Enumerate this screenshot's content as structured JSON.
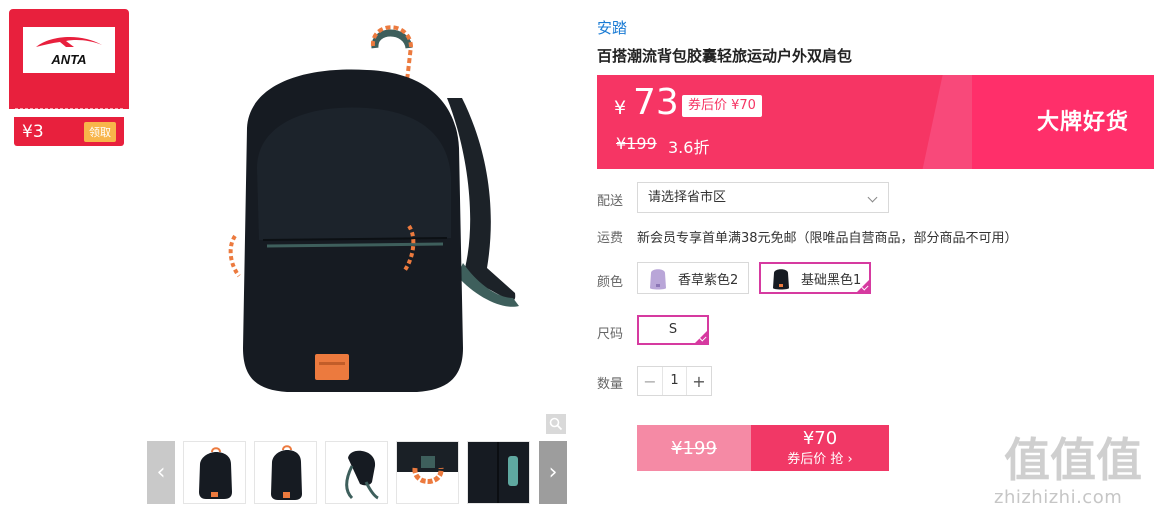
{
  "coupon": {
    "brand_logo_text": "ANTA",
    "amount": "¥3",
    "claim_label": "领取",
    "color": "#e8203d"
  },
  "gallery": {
    "zoom_icon": "magnifier-icon",
    "prev_icon": "chevron-left-icon",
    "next_icon": "chevron-right-icon",
    "thumbnails": [
      "backpack-front",
      "backpack-front-angle",
      "backpack-back-straps",
      "backpack-handle-detail",
      "backpack-side-pocket"
    ]
  },
  "product": {
    "brand": "安踏",
    "title": "百搭潮流背包胶囊轻旅运动户外双肩包"
  },
  "price_banner": {
    "yen": "¥",
    "price": "73",
    "after_coupon": "券后价 ¥70",
    "original_price": "¥199",
    "discount": "3.6折",
    "slogan": "大牌好货",
    "color": "#f63564"
  },
  "delivery": {
    "label": "配送",
    "placeholder": "请选择省市区"
  },
  "freight": {
    "label": "运费",
    "text": "新会员专享首单满38元免邮（限唯品自营商品，部分商品不可用）"
  },
  "colors": {
    "label": "颜色",
    "options": [
      {
        "label": "香草紫色2",
        "selected": false
      },
      {
        "label": "基础黑色1",
        "selected": true
      }
    ],
    "selected_color": "#d63aa0"
  },
  "size": {
    "label": "尺码",
    "options": [
      {
        "label": "S",
        "selected": true
      }
    ]
  },
  "quantity": {
    "label": "数量",
    "value": "1",
    "minus": "−",
    "plus": "+"
  },
  "buy": {
    "original_price": "¥199",
    "coupon_price": "¥70",
    "action_label": "券后价 抢 ›"
  },
  "watermark": {
    "logo_text": "值值值",
    "url": "zhizhizhi.com"
  }
}
